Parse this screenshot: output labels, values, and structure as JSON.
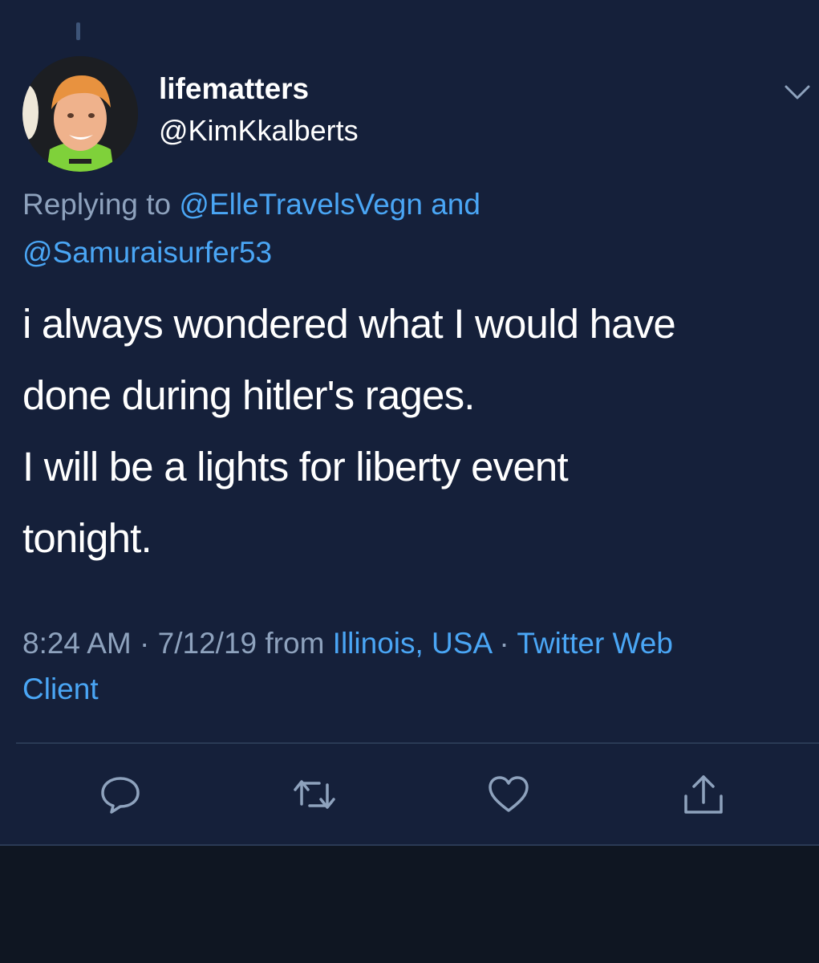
{
  "tweet": {
    "display_name": "lifematters",
    "handle": "@KimKkalberts",
    "replying_prefix": "Replying to ",
    "reply_to_1": "@ElleTravelsVegn",
    "reply_and": " and",
    "reply_to_2": "@Samuraisurfer53",
    "text_lines": [
      "i always wondered what I would have",
      "done during hitler's rages.",
      "I will be a lights for liberty event",
      "tonight."
    ],
    "time": "8:24 AM",
    "sep1": " · ",
    "date": "7/12/19",
    "from_label": " from ",
    "location": "Illinois, USA",
    "sep2": " · ",
    "client_part1": "Twitter Web",
    "client_part2": "Client"
  },
  "icons": {
    "menu": "chevron-down-icon",
    "reply": "reply-icon",
    "retweet": "retweet-icon",
    "like": "heart-icon",
    "share": "share-icon"
  },
  "colors": {
    "background": "#15203a",
    "text": "#ffffff",
    "link": "#4aa6f5",
    "muted": "#8ea2bd",
    "icon": "#8ea2bd"
  }
}
